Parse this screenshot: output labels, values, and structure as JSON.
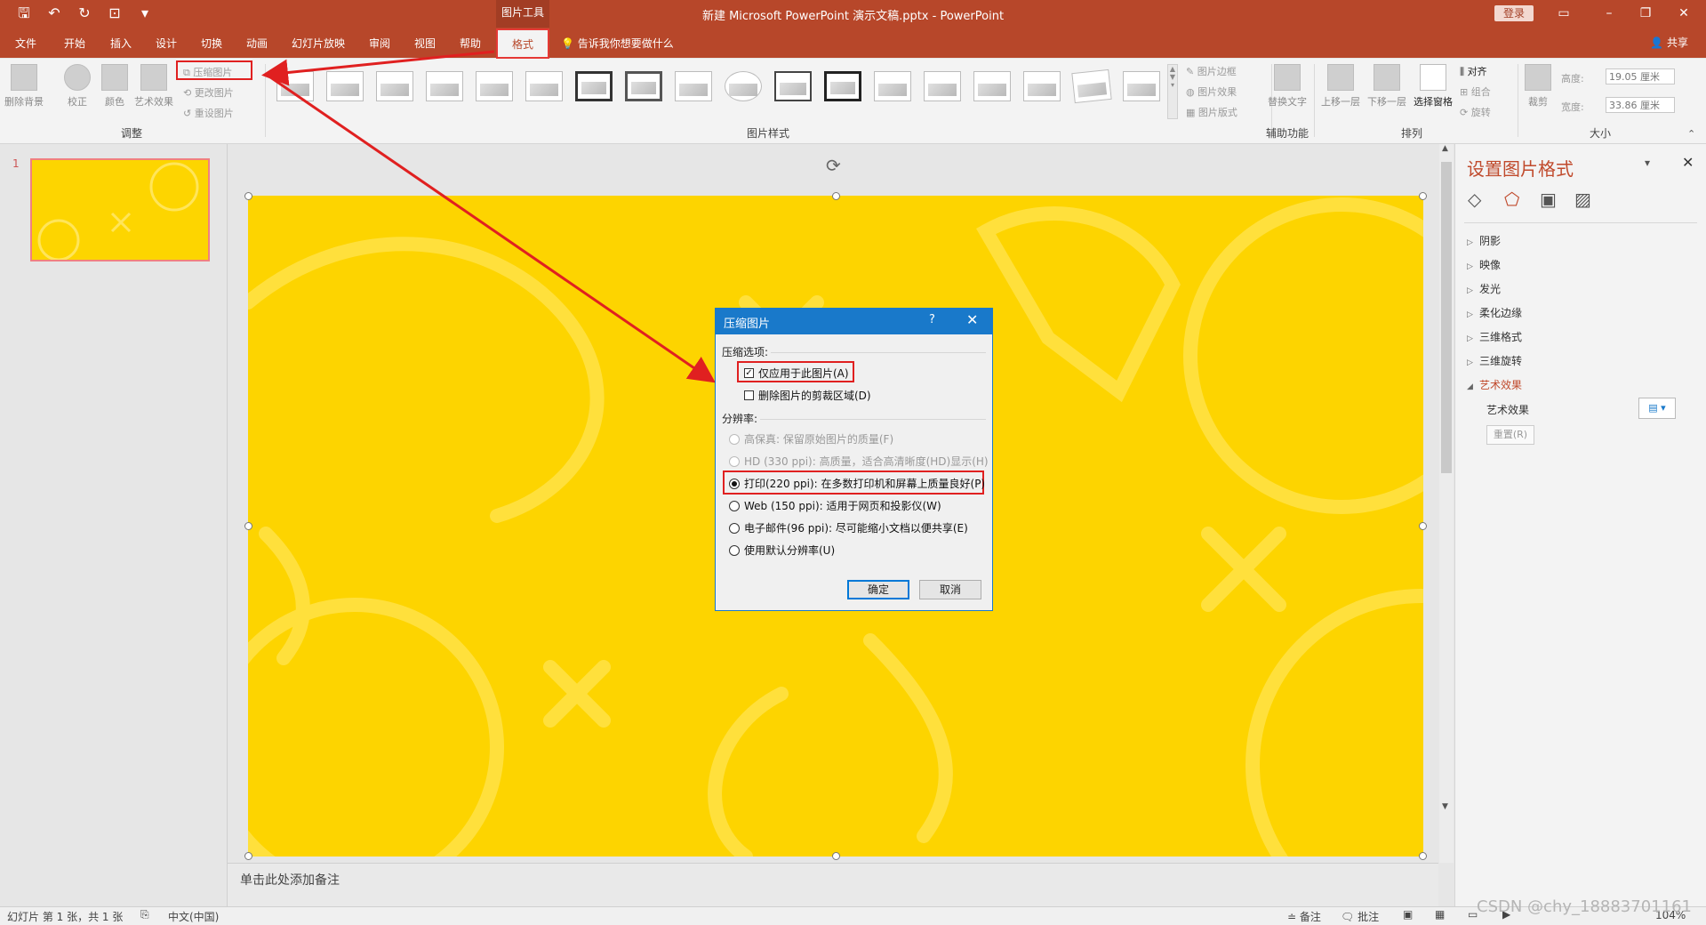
{
  "titlebar": {
    "title": "新建 Microsoft PowerPoint 演示文稿.pptx  -  PowerPoint",
    "context_tool": "图片工具",
    "login": "登录"
  },
  "tabs": [
    "文件",
    "开始",
    "插入",
    "设计",
    "切换",
    "动画",
    "幻灯片放映",
    "审阅",
    "视图",
    "帮助"
  ],
  "format_tab": "格式",
  "tell_me": "告诉我你想要做什么",
  "share": "共享",
  "ribbon": {
    "adjust": {
      "remove_bg": "删除背景",
      "correct": "校正",
      "color": "颜色",
      "artistic": "艺术效果",
      "compress": "压缩图片",
      "change": "更改图片",
      "reset": "重设图片",
      "label": "调整"
    },
    "styles": {
      "label": "图片样式",
      "border": "图片边框",
      "effects": "图片效果",
      "layout": "图片版式"
    },
    "accessibility": {
      "alt_text": "替换文字",
      "label": "辅助功能"
    },
    "arrange": {
      "forward": "上移一层",
      "backward": "下移一层",
      "selection_pane": "选择窗格",
      "align": "对齐",
      "group": "组合",
      "rotate": "旋转",
      "label": "排列"
    },
    "size": {
      "crop": "裁剪",
      "height_label": "高度:",
      "height_value": "19.05 厘米",
      "width_label": "宽度:",
      "width_value": "33.86 厘米",
      "label": "大小"
    }
  },
  "slides_pane": {
    "slide_number": "1"
  },
  "notes_placeholder": "单击此处添加备注",
  "format_pane": {
    "title": "设置图片格式",
    "items": [
      "阴影",
      "映像",
      "发光",
      "柔化边缘",
      "三维格式",
      "三维旋转",
      "艺术效果"
    ],
    "artistic_label": "艺术效果",
    "reset": "重置(R)"
  },
  "dialog": {
    "title": "压缩图片",
    "help": "?",
    "compression_section": "压缩选项:",
    "apply_only": "仅应用于此图片(A)",
    "delete_cropped": "删除图片的剪裁区域(D)",
    "resolution_section": "分辨率:",
    "options": [
      "高保真: 保留原始图片的质量(F)",
      "HD (330 ppi): 高质量，适合高清晰度(HD)显示(H)",
      "打印(220 ppi): 在多数打印机和屏幕上质量良好(P)",
      "Web (150 ppi): 适用于网页和投影仪(W)",
      "电子邮件(96 ppi): 尽可能缩小文档以便共享(E)",
      "使用默认分辨率(U)"
    ],
    "ok": "确定",
    "cancel": "取消"
  },
  "status": {
    "slide_info": "幻灯片 第 1 张，共 1 张",
    "language": "中文(中国)",
    "notes": "备注",
    "comments": "批注",
    "zoom": "104%"
  },
  "watermark": "CSDN @chy_18883701161"
}
